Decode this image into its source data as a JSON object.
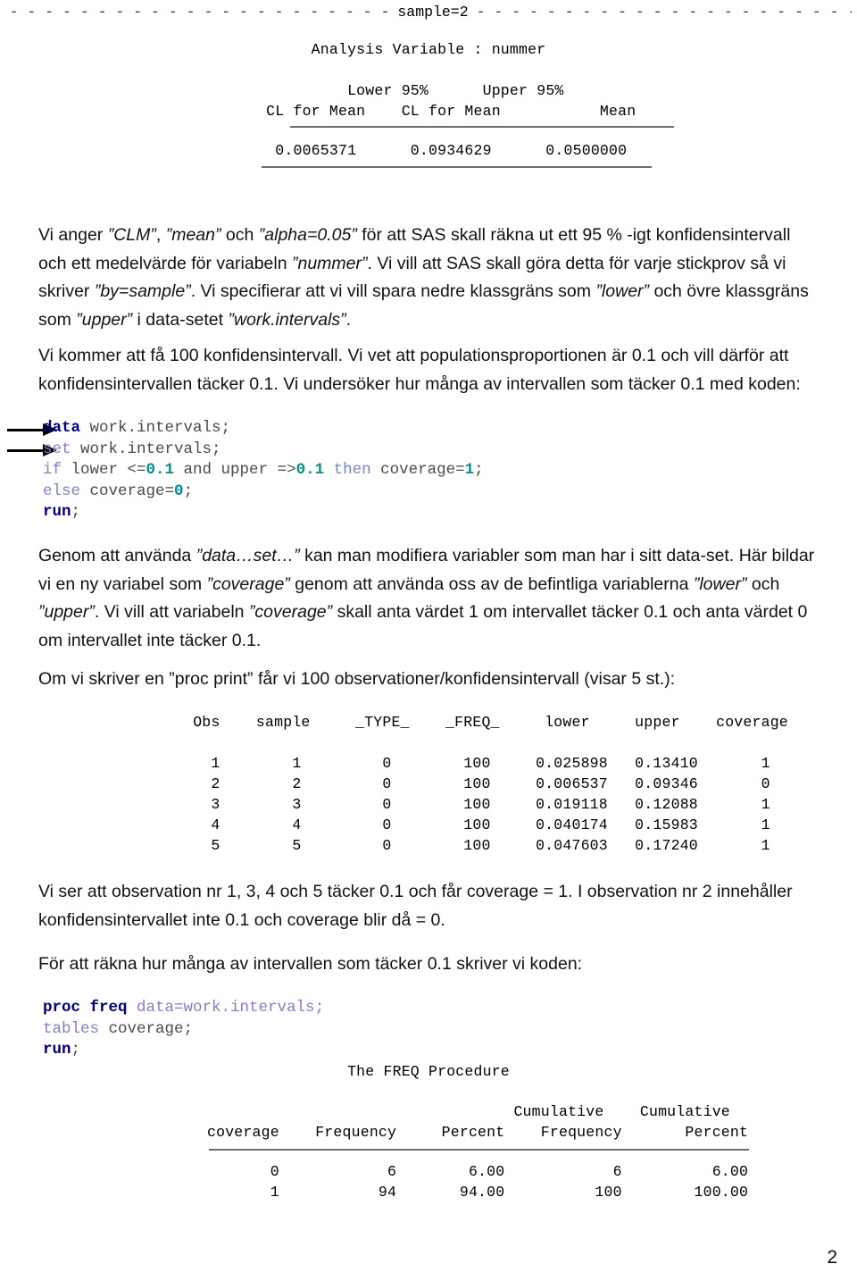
{
  "document": {
    "page_number": "2",
    "banner": {
      "dash_char": "- ",
      "label": "sample=2"
    }
  },
  "means_output": {
    "title": "Analysis Variable : nummer",
    "headers": [
      [
        "Lower 95%",
        "Upper 95%",
        ""
      ],
      [
        "CL for Mean",
        "CL for Mean",
        "Mean"
      ]
    ],
    "row": [
      "0.0065371",
      "0.0934629",
      "0.0500000"
    ],
    "header_line_1": "      Lower 95%      Upper 95%",
    "header_line_2": "     CL for Mean    CL for Mean           Mean",
    "value_line": "     0.0065371      0.0934629      0.0500000"
  },
  "paragraphs": {
    "p1": {
      "runs": [
        {
          "t": "Vi anger ",
          "i": false
        },
        {
          "t": "”CLM”",
          "i": true
        },
        {
          "t": ", ",
          "i": false
        },
        {
          "t": "”mean”",
          "i": true
        },
        {
          "t": " och ",
          "i": false
        },
        {
          "t": "”alpha=0.05”",
          "i": true
        },
        {
          "t": " för att SAS skall räkna ut ett 95 % -igt konfidensintervall och ett medelvärde för variabeln ",
          "i": false
        },
        {
          "t": "”nummer”",
          "i": true
        },
        {
          "t": ". Vi vill att SAS skall göra detta för varje stickprov så vi skriver ",
          "i": false
        },
        {
          "t": "”by=sample”",
          "i": true
        },
        {
          "t": ". Vi specifierar att vi vill spara nedre klassgräns som ",
          "i": false
        },
        {
          "t": "”lower”",
          "i": true
        },
        {
          "t": " och övre klassgräns som ",
          "i": false
        },
        {
          "t": "”upper”",
          "i": true
        },
        {
          "t": " i data-setet ",
          "i": false
        },
        {
          "t": "”work.intervals”",
          "i": true
        },
        {
          "t": ".",
          "i": false
        }
      ]
    },
    "p2": {
      "runs": [
        {
          "t": "Vi kommer att få 100 konfidensintervall. Vi vet att populationsproportionen är 0.1 och vill därför att konfidensintervallen täcker 0.1. Vi undersöker hur många av intervallen som täcker 0.1 med koden:",
          "i": false
        }
      ]
    },
    "p3": {
      "runs": [
        {
          "t": "Genom att använda ",
          "i": false
        },
        {
          "t": "”data…set…”",
          "i": true
        },
        {
          "t": " kan man modifiera variabler som man har i sitt data-set. Här bildar vi en ny variabel som ",
          "i": false
        },
        {
          "t": "”coverage”",
          "i": true
        },
        {
          "t": " genom att använda oss av de befintliga variablerna ",
          "i": false
        },
        {
          "t": "”lower”",
          "i": true
        },
        {
          "t": " och ",
          "i": false
        },
        {
          "t": "”upper”",
          "i": true
        },
        {
          "t": ". Vi vill att variabeln ",
          "i": false
        },
        {
          "t": "”coverage”",
          "i": true
        },
        {
          "t": " skall anta värdet 1 om intervallet täcker 0.1 och anta värdet 0 om intervallet inte täcker 0.1.",
          "i": false
        }
      ]
    },
    "p4": {
      "runs": [
        {
          "t": "Om vi skriver en ",
          "i": false
        },
        {
          "t": "”proc print”",
          "i": false
        },
        {
          "t": " får vi 100 observationer/konfidensintervall (visar 5 st.):",
          "i": false
        }
      ]
    },
    "p5": {
      "runs": [
        {
          "t": "Vi ser att observation nr 1, 3, 4 och 5 täcker 0.1 och får coverage = 1. I observation nr 2 innehåller konfidensintervallet inte 0.1 och coverage blir då = 0.",
          "i": false
        }
      ]
    },
    "p6": {
      "runs": [
        {
          "t": "För att räkna hur många av intervallen som täcker 0.1 skriver vi koden:",
          "i": false
        }
      ]
    }
  },
  "code_block_1": {
    "arrow_count": 2,
    "lines": [
      [
        {
          "t": "data",
          "c": "kw"
        },
        {
          "t": " work.intervals;",
          "c": "plain"
        }
      ],
      [
        {
          "t": "set",
          "c": "kw2"
        },
        {
          "t": " work.intervals;",
          "c": "plain"
        }
      ],
      [
        {
          "t": "if",
          "c": "kw2"
        },
        {
          "t": " lower <=",
          "c": "plain"
        },
        {
          "t": "0.1",
          "c": "num"
        },
        {
          "t": " and upper =>",
          "c": "plain"
        },
        {
          "t": "0.1",
          "c": "num"
        },
        {
          "t": " ",
          "c": "plain"
        },
        {
          "t": "then",
          "c": "kw2"
        },
        {
          "t": " coverage=",
          "c": "plain"
        },
        {
          "t": "1",
          "c": "num"
        },
        {
          "t": ";",
          "c": "plain"
        }
      ],
      [
        {
          "t": "else",
          "c": "kw2"
        },
        {
          "t": " coverage=",
          "c": "plain"
        },
        {
          "t": "0",
          "c": "num"
        },
        {
          "t": ";",
          "c": "plain"
        }
      ],
      [
        {
          "t": "run",
          "c": "kw"
        },
        {
          "t": ";",
          "c": "plain"
        }
      ]
    ]
  },
  "code_block_2": {
    "lines": [
      [
        {
          "t": "proc freq",
          "c": "kw"
        },
        {
          "t": " ",
          "c": "plain"
        },
        {
          "t": "data=work.intervals;",
          "c": "kw2"
        }
      ],
      [
        {
          "t": "tables",
          "c": "kw2"
        },
        {
          "t": " coverage;",
          "c": "plain"
        }
      ],
      [
        {
          "t": "run",
          "c": "kw"
        },
        {
          "t": ";",
          "c": "plain"
        }
      ]
    ]
  },
  "print_output": {
    "columns": [
      "Obs",
      "sample",
      "_TYPE_",
      "_FREQ_",
      "lower",
      "upper",
      "coverage"
    ],
    "header_line": "  Obs    sample     _TYPE_    _FREQ_     lower     upper    coverage",
    "rows": [
      [
        "1",
        "1",
        "0",
        "100",
        "0.025898",
        "0.13410",
        "1"
      ],
      [
        "2",
        "2",
        "0",
        "100",
        "0.006537",
        "0.09346",
        "0"
      ],
      [
        "3",
        "3",
        "0",
        "100",
        "0.019118",
        "0.12088",
        "1"
      ],
      [
        "4",
        "4",
        "0",
        "100",
        "0.040174",
        "0.15983",
        "1"
      ],
      [
        "5",
        "5",
        "0",
        "100",
        "0.047603",
        "0.17240",
        "1"
      ]
    ],
    "row_lines": [
      "    1        1         0        100     0.025898   0.13410       1",
      "    2        2         0        100     0.006537   0.09346       0",
      "    3        3         0        100     0.019118   0.12088       1",
      "    4        4         0        100     0.040174   0.15983       1",
      "    5        5         0        100     0.047603   0.17240       1"
    ]
  },
  "freq_output": {
    "title": "The FREQ Procedure",
    "header_line_1": "                                  Cumulative    Cumulative",
    "header_line_2": "coverage    Frequency     Percent    Frequency       Percent",
    "columns": [
      "coverage",
      "Frequency",
      "Percent",
      "Cumulative Frequency",
      "Cumulative Percent"
    ],
    "rows": [
      [
        "0",
        "6",
        "6.00",
        "6",
        "6.00"
      ],
      [
        "1",
        "94",
        "94.00",
        "100",
        "100.00"
      ]
    ],
    "row_lines": [
      "       0            6        6.00            6          6.00",
      "       1           94       94.00          100        100.00"
    ]
  },
  "colors": {
    "keyword": "#000080",
    "keyword_light": "#7b83c4",
    "number": "#068b8b",
    "rule": "#6e6e6e",
    "text": "#111111"
  }
}
